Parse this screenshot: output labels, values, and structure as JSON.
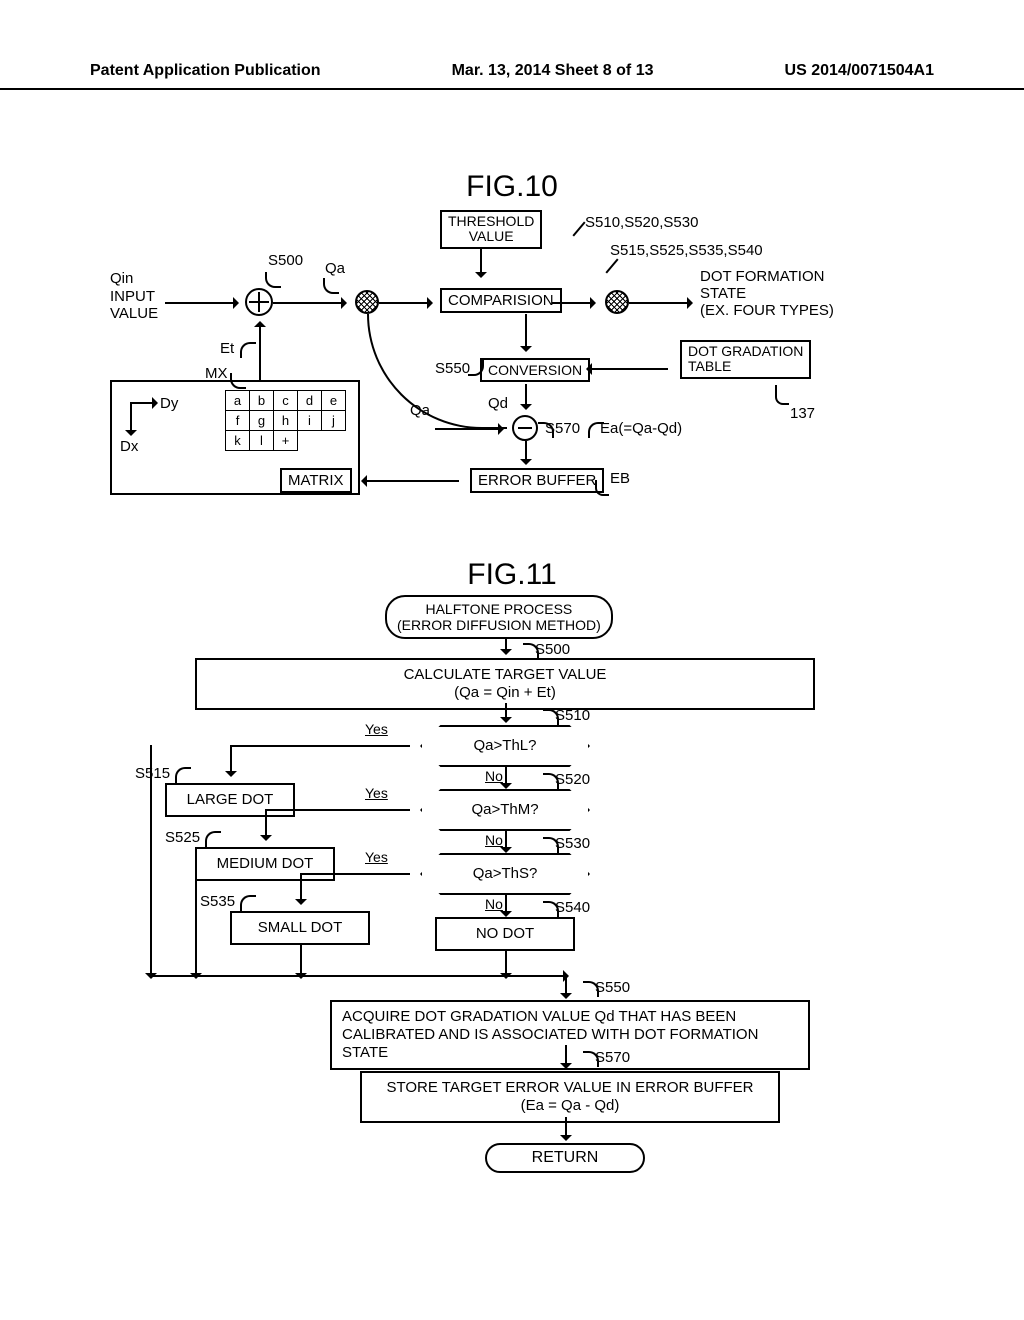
{
  "header": {
    "left": "Patent Application Publication",
    "center": "Mar. 13, 2014  Sheet 8 of 13",
    "right": "US 2014/0071504A1"
  },
  "fig10": {
    "title": "FIG.10",
    "input_key": "Qin",
    "input_label": "INPUT\nVALUE",
    "s500": "S500",
    "qa": "Qa",
    "threshold_box": "THRESHOLD\nVALUE",
    "sright_top": "S510,S520,S530",
    "sright_second": "S515,S525,S535,S540",
    "comparison": "COMPARISION",
    "dot_state": "DOT FORMATION\nSTATE\n(EX. FOUR TYPES)",
    "et": "Et",
    "mx": "MX",
    "conversion": "CONVERSION",
    "s550": "S550",
    "qd": "Qd",
    "qa2": "Qa",
    "s570": "S570",
    "ea": "Ea(=Qa-Qd)",
    "dot_table": "DOT GRADATION\nTABLE",
    "dot_table_ref": "137",
    "matrix": "MATRIX",
    "error_buffer": "ERROR BUFFER",
    "eb": "EB",
    "dy": "Dy",
    "dx": "Dx",
    "mx_cells": [
      "a",
      "b",
      "c",
      "d",
      "e",
      "f",
      "g",
      "h",
      "i",
      "j",
      "k",
      "l",
      "+"
    ]
  },
  "fig11": {
    "title": "FIG.11",
    "start": "HALFTONE PROCESS\n(ERROR DIFFUSION METHOD)",
    "s500box": "CALCULATE TARGET VALUE\n(Qa = Qin + Et)",
    "s500": "S500",
    "d1": "Qa>ThL?",
    "s510": "S510",
    "d2": "Qa>ThM?",
    "s520": "S520",
    "d3": "Qa>ThS?",
    "s530": "S530",
    "large": "LARGE DOT",
    "s515": "S515",
    "medium": "MEDIUM DOT",
    "s525": "S525",
    "small": "SMALL DOT",
    "s535": "S535",
    "nodot": "NO DOT",
    "s540": "S540",
    "yes": "Yes",
    "no": "No",
    "s550box": "ACQUIRE DOT GRADATION VALUE Qd THAT HAS BEEN\nCALIBRATED AND IS ASSOCIATED WITH DOT FORMATION STATE",
    "s550": "S550",
    "s570box": "STORE TARGET ERROR VALUE IN ERROR BUFFER\n(Ea = Qa - Qd)",
    "s570": "S570",
    "return": "RETURN"
  }
}
